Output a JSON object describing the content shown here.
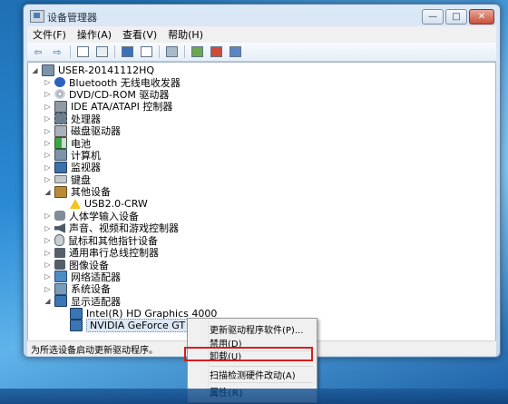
{
  "window": {
    "title": "设备管理器",
    "controls": {
      "minimize": "—",
      "maximize": "□",
      "close": "✕"
    }
  },
  "menubar": [
    {
      "label": "文件(F)"
    },
    {
      "label": "操作(A)"
    },
    {
      "label": "查看(V)"
    },
    {
      "label": "帮助(H)"
    }
  ],
  "toolbar": {
    "back": "⇦",
    "forward": "⇨"
  },
  "tree": {
    "root": "USER-20141112HQ",
    "items": [
      {
        "label": "Bluetooth 无线电收发器",
        "expander": "▷",
        "icon": "bluetooth-icon"
      },
      {
        "label": "DVD/CD-ROM 驱动器",
        "expander": "▷",
        "icon": "dvd-icon"
      },
      {
        "label": "IDE ATA/ATAPI 控制器",
        "expander": "▷",
        "icon": "ide-controller-icon"
      },
      {
        "label": "处理器",
        "expander": "▷",
        "icon": "processor-icon"
      },
      {
        "label": "磁盘驱动器",
        "expander": "▷",
        "icon": "disk-drive-icon"
      },
      {
        "label": "电池",
        "expander": "▷",
        "icon": "battery-icon"
      },
      {
        "label": "计算机",
        "expander": "▷",
        "icon": "computer-icon"
      },
      {
        "label": "监视器",
        "expander": "▷",
        "icon": "monitor-icon"
      },
      {
        "label": "键盘",
        "expander": "▷",
        "icon": "keyboard-icon"
      },
      {
        "label": "其他设备",
        "expander": "◢",
        "icon": "other-devices-icon"
      },
      {
        "label": "USB2.0-CRW",
        "expander": "",
        "icon": "warning-icon",
        "child": true
      },
      {
        "label": "人体学输入设备",
        "expander": "▷",
        "icon": "hid-icon"
      },
      {
        "label": "声音、视频和游戏控制器",
        "expander": "▷",
        "icon": "sound-icon"
      },
      {
        "label": "鼠标和其他指针设备",
        "expander": "▷",
        "icon": "mouse-icon"
      },
      {
        "label": "通用串行总线控制器",
        "expander": "▷",
        "icon": "usb-icon"
      },
      {
        "label": "图像设备",
        "expander": "▷",
        "icon": "camera-icon"
      },
      {
        "label": "网络适配器",
        "expander": "▷",
        "icon": "network-adapter-icon"
      },
      {
        "label": "系统设备",
        "expander": "▷",
        "icon": "system-device-icon"
      },
      {
        "label": "显示适配器",
        "expander": "◢",
        "icon": "display-adapter-icon"
      },
      {
        "label": "Intel(R) HD Graphics 4000",
        "expander": "",
        "icon": "display-adapter-icon",
        "child": true
      },
      {
        "label": "NVIDIA GeForce GT 740M",
        "expander": "",
        "icon": "display-adapter-icon",
        "child": true,
        "selected": true
      }
    ]
  },
  "status": "为所选设备启动更新驱动程序。",
  "context_menu": {
    "update_driver": "更新驱动程序软件(P)...",
    "disable": "禁用(D)",
    "uninstall": "卸载(U)",
    "scan": "扫描检测硬件改动(A)",
    "properties": "属性(R)"
  }
}
